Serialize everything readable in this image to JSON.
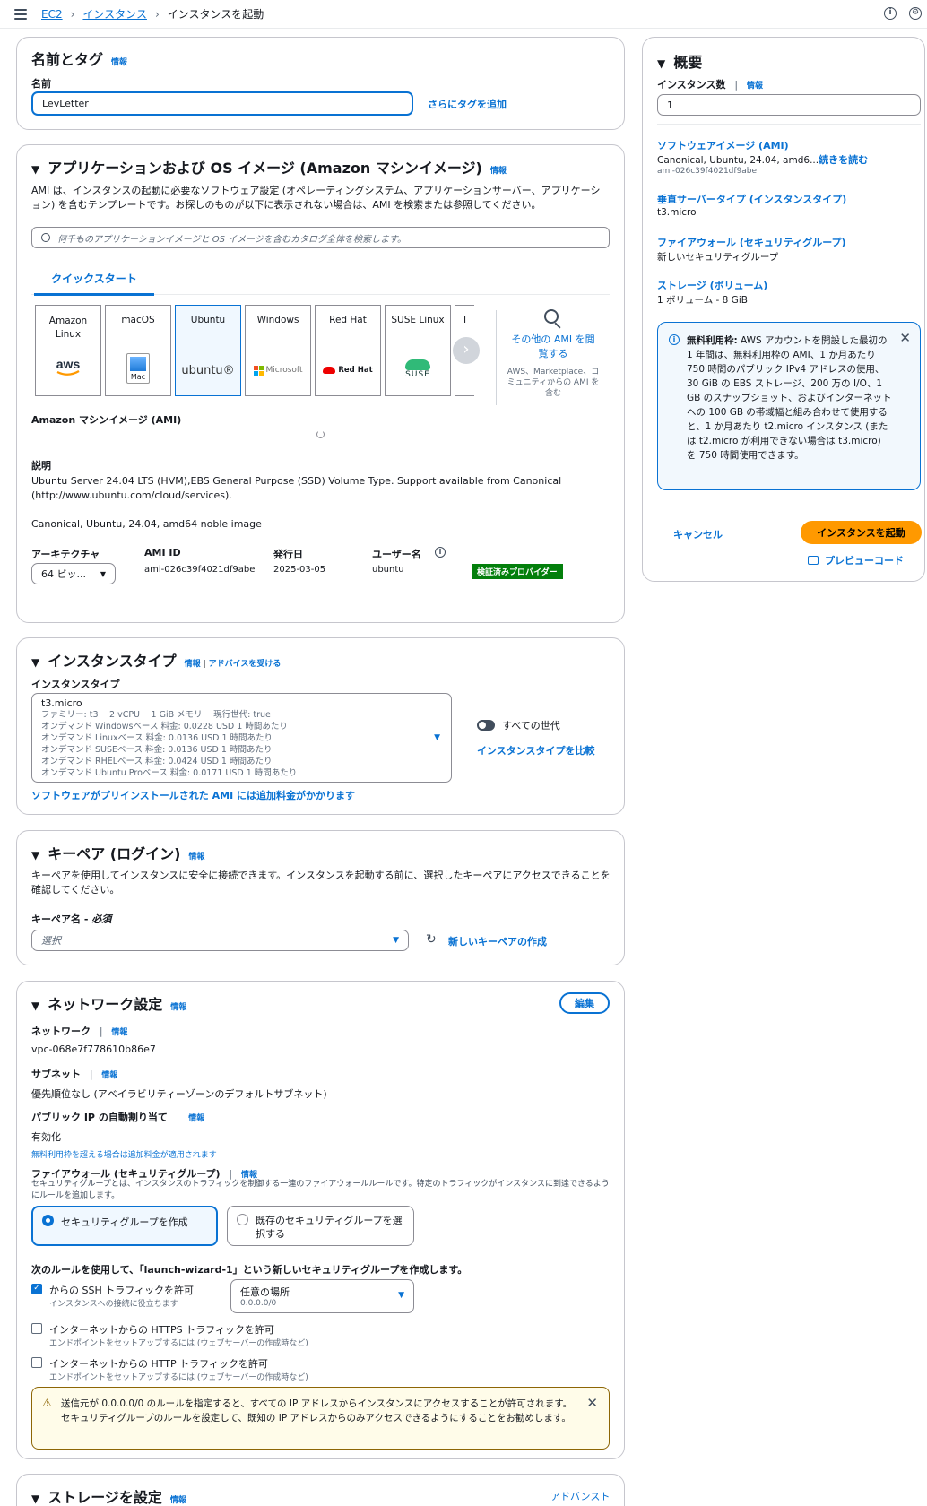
{
  "breadcrumb": {
    "root": "EC2",
    "parent": "インスタンス",
    "current": "インスタンスを起動"
  },
  "name_tags": {
    "title": "名前とタグ",
    "info": "情報",
    "name_label": "名前",
    "name_value": "LevLetter",
    "add_tags": "さらにタグを追加"
  },
  "ami": {
    "title": "アプリケーションおよび OS イメージ (Amazon マシンイメージ)",
    "info": "情報",
    "desc": "AMI は、インスタンスの起動に必要なソフトウェア設定 (オペレーティングシステム、アプリケーションサーバー、アプリケーション) を含むテンプレートです。お探しのものが以下に表示されない場合は、AMI を検索または参照してください。",
    "search_placeholder": "何千ものアプリケーションイメージと OS イメージを含むカタログ全体を検索します。",
    "tab": "クイックスタート",
    "tiles": [
      {
        "name": "Amazon Linux",
        "logo": "aws"
      },
      {
        "name": "macOS",
        "logo": "Mac"
      },
      {
        "name": "Ubuntu",
        "logo": "ubuntu®"
      },
      {
        "name": "Windows",
        "logo": "Microsoft"
      },
      {
        "name": "Red Hat",
        "logo": "Red Hat"
      },
      {
        "name": "SUSE Linux",
        "logo": "SUSE"
      },
      {
        "name": "I",
        "logo": ""
      }
    ],
    "browse_more": "その他の AMI を閲覧する",
    "browse_note": "AWS、Marketplace、コミュニティからの AMI を含む",
    "ami_label": "Amazon マシンイメージ (AMI)",
    "desc_label": "説明",
    "description_line1": "Ubuntu Server 24.04 LTS (HVM),EBS General Purpose (SSD) Volume Type. Support available from Canonical",
    "description_line2": "(http://www.ubuntu.com/cloud/services).",
    "summary_line": "Canonical, Ubuntu, 24.04, amd64 noble image",
    "arch_label": "アーキテクチャ",
    "arch_value": "64 ビッ...",
    "amiid_label": "AMI ID",
    "amiid_value": "ami-026c39f4021df9abe",
    "date_label": "発行日",
    "date_value": "2025-03-05",
    "user_label": "ユーザー名",
    "user_value": "ubuntu",
    "verified": "検証済みプロバイダー"
  },
  "instance_type": {
    "title": "インスタンスタイプ",
    "info": "情報",
    "advice": "アドバイスを受ける",
    "label": "インスタンスタイプ",
    "selected": "t3.micro",
    "lines": [
      "ファミリー: t3　 2 vCPU　 1 GiB メモリ　 現行世代: true",
      "オンデマンド Windowsベース 料金: 0.0228 USD 1 時間あたり",
      "オンデマンド Linuxベース 料金: 0.0136 USD 1 時間あたり",
      "オンデマンド SUSEベース 料金: 0.0136 USD 1 時間あたり",
      "オンデマンド RHELベース 料金: 0.0424 USD 1 時間あたり",
      "オンデマンド Ubuntu Proベース 料金: 0.0171 USD 1 時間あたり"
    ],
    "all_gen": "すべての世代",
    "compare": "インスタンスタイプを比較",
    "extra_charge": "ソフトウェアがプリインストールされた AMI には追加料金がかかります"
  },
  "keypair": {
    "title": "キーペア (ログイン)",
    "info": "情報",
    "desc": "キーペアを使用してインスタンスに安全に接続できます。インスタンスを起動する前に、選択したキーペアにアクセスできることを確認してください。",
    "label": "キーペア名 - ",
    "required": "必須",
    "placeholder": "選択",
    "create": "新しいキーペアの作成"
  },
  "network": {
    "title": "ネットワーク設定",
    "info": "情報",
    "edit": "編集",
    "network_label": "ネットワーク",
    "network_value": "vpc-068e7f778610b86e7",
    "subnet_label": "サブネット",
    "subnet_value": "優先順位なし (アベイラビリティーゾーンのデフォルトサブネット)",
    "publicip_label": "パブリック IP の自動割り当て",
    "publicip_value": "有効化",
    "free_note_a": "無料利用枠を超える場合は",
    "free_note_b": "追加料金が適用されます",
    "firewall_label": "ファイアウォール (セキュリティグループ)",
    "firewall_desc": "セキュリティグループとは、インスタンスのトラフィックを制御する一連のファイアウォールルールです。特定のトラフィックがインスタンスに到達できるようにルールを追加します。",
    "opt_create": "セキュリティグループを作成",
    "opt_existing": "既存のセキュリティグループを選択する",
    "rule_intro": "次のルールを使用して、「launch-wizard-1」という新しいセキュリティグループを作成します。",
    "ssh_label": "からの SSH トラフィックを許可",
    "ssh_sub": "インスタンスへの接続に役立ちます",
    "ssh_source": "任意の場所",
    "ssh_cidr": "0.0.0.0/0",
    "https_label": "インターネットからの HTTPS トラフィックを許可",
    "https_sub": "エンドポイントをセットアップするには (ウェブサーバーの作成時など)",
    "http_label": "インターネットからの HTTP トラフィックを許可",
    "http_sub": "エンドポイントをセットアップするには (ウェブサーバーの作成時など)",
    "warning": "送信元が 0.0.0.0/0 のルールを指定すると、すべての IP アドレスからインスタンスにアクセスすることが許可されます。セキュリティグループのルールを設定して、既知の IP アドレスからのみアクセスできるようにすることをお勧めします。"
  },
  "storage": {
    "title": "ストレージを設定",
    "info": "情報",
    "advanced": "アドバンスト"
  },
  "summary": {
    "title": "概要",
    "count_label": "インスタンス数",
    "info": "情報",
    "count_value": "1",
    "ami_link": "ソフトウェアイメージ (AMI)",
    "ami_value": "Canonical, Ubuntu, 24.04, amd6...",
    "ami_more": "続きを読む",
    "ami_id": "ami-026c39f4021df9abe",
    "type_link": "垂直サーバータイプ (インスタンスタイプ)",
    "type_value": "t3.micro",
    "fw_link": "ファイアウォール (セキュリティグループ)",
    "fw_value": "新しいセキュリティグループ",
    "storage_link": "ストレージ (ボリューム)",
    "storage_value": "1 ボリューム - 8 GiB",
    "free_title": "無料利用枠:",
    "free_text": " AWS アカウントを開設した最初の 1 年間は、無料利用枠の AMI、1 か月あたり 750 時間のパブリック IPv4 アドレスの使用、30 GiB の EBS ストレージ、200 万の I/O、1 GB のスナップショット、およびインターネットへの 100 GB の帯域幅と組み合わせて使用すると、1 か月あたり t2.micro インスタンス (または t2.micro が利用できない場合は t3.micro) を 750 時間使用できます。",
    "cancel": "キャンセル",
    "launch": "インスタンスを起動",
    "preview": "プレビューコード"
  },
  "colors": {
    "link": "#0972d3",
    "launch": "#ff9900",
    "verified": "#037f0c",
    "warn_border": "#8d6605"
  }
}
